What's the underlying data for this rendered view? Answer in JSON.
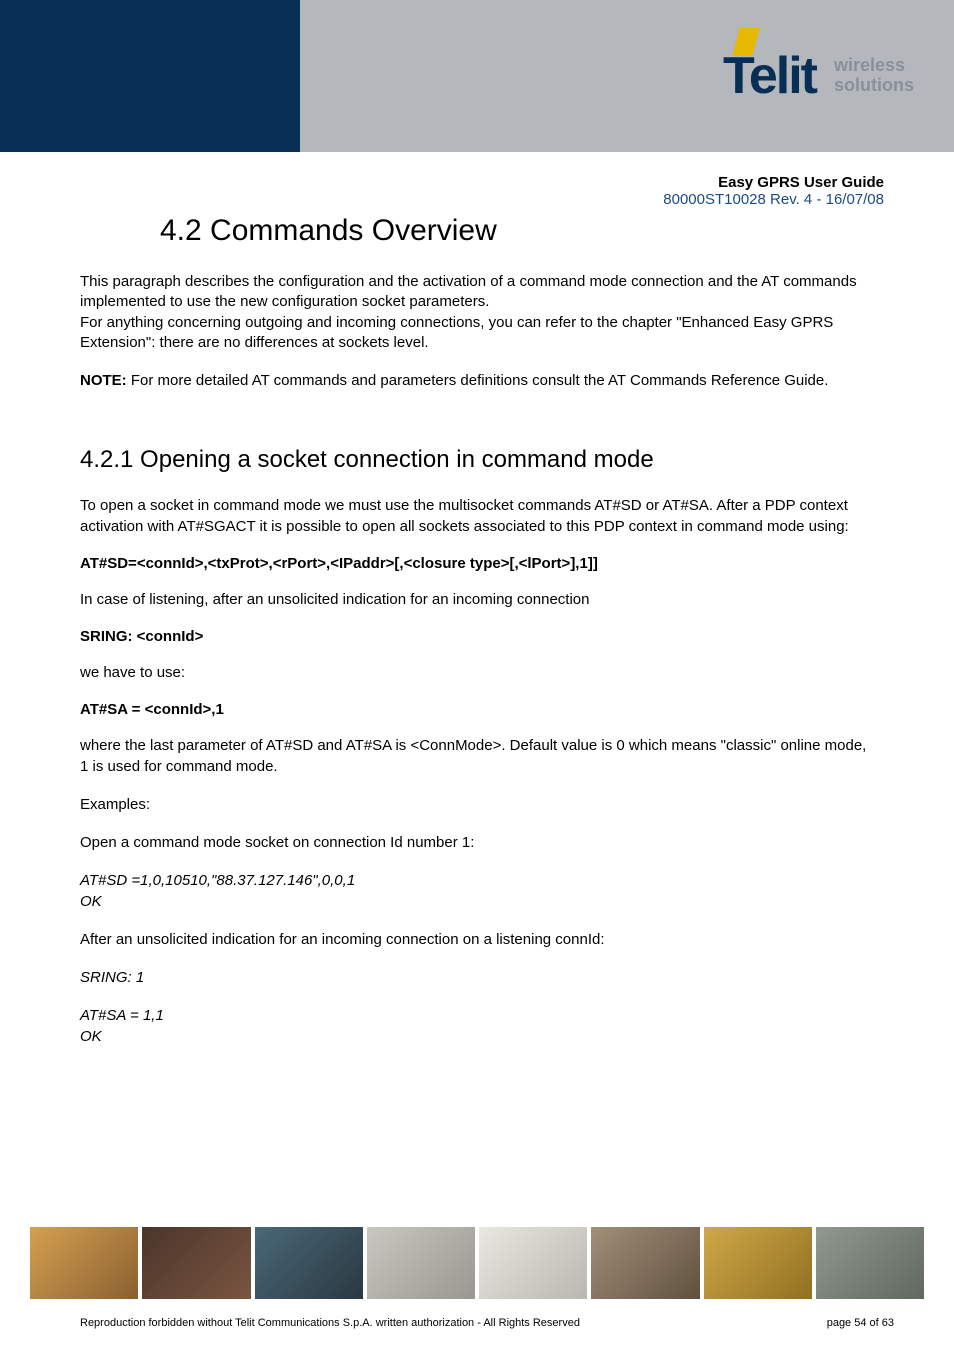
{
  "header": {
    "logo_text": "Telit",
    "tagline_1": "wireless",
    "tagline_2": "solutions"
  },
  "doc": {
    "title": "Easy GPRS User Guide",
    "revision": "80000ST10028 Rev. 4 - 16/07/08"
  },
  "section": {
    "heading": "4.2  Commands Overview",
    "intro_para": "This paragraph describes the configuration and the activation of a command mode connection and the AT commands implemented to use the new configuration socket parameters.\nFor anything concerning outgoing and incoming connections, you can refer to the chapter \"Enhanced Easy GPRS Extension\": there are no differences at sockets level.",
    "note_label": "NOTE:",
    "note_text": " For more detailed AT commands and parameters definitions consult the AT Commands Reference Guide."
  },
  "subsection": {
    "heading": "4.2.1 Opening a socket connection in command mode",
    "p1": "To open a socket in command mode we must use the multisocket commands AT#SD or AT#SA. After a PDP context activation with AT#SGACT it is possible to open all sockets associated to this PDP context in command mode using:",
    "cmd1": "AT#SD=<connId>,<txProt>,<rPort>,<IPaddr>[,<closure type>[,<lPort>],1]]",
    "p2": "In case of listening, after an unsolicited indication for an incoming connection",
    "cmd2": "SRING: <connId>",
    "p3": "we have to use:",
    "cmd3": "AT#SA = <connId>,1",
    "p4": "where the last parameter of AT#SD and AT#SA is <ConnMode>. Default value is 0 which means \"classic\" online mode, 1 is used for command mode.",
    "examples_label": "Examples:",
    "ex1_desc": "Open a command mode socket on connection Id number 1:",
    "ex1_cmd": "AT#SD =1,0,10510,\"88.37.127.146\",0,0,1",
    "ex1_ok": "OK",
    "ex2_desc": "After an unsolicited indication for an incoming connection on a listening connId:",
    "ex2_sring": "SRING: 1",
    "ex2_cmd": "AT#SA = 1,1",
    "ex2_ok": "OK"
  },
  "footer": {
    "copyright": "Reproduction forbidden without Telit Communications S.p.A. written authorization - All Rights Reserved",
    "page": "page 54 of 63"
  }
}
